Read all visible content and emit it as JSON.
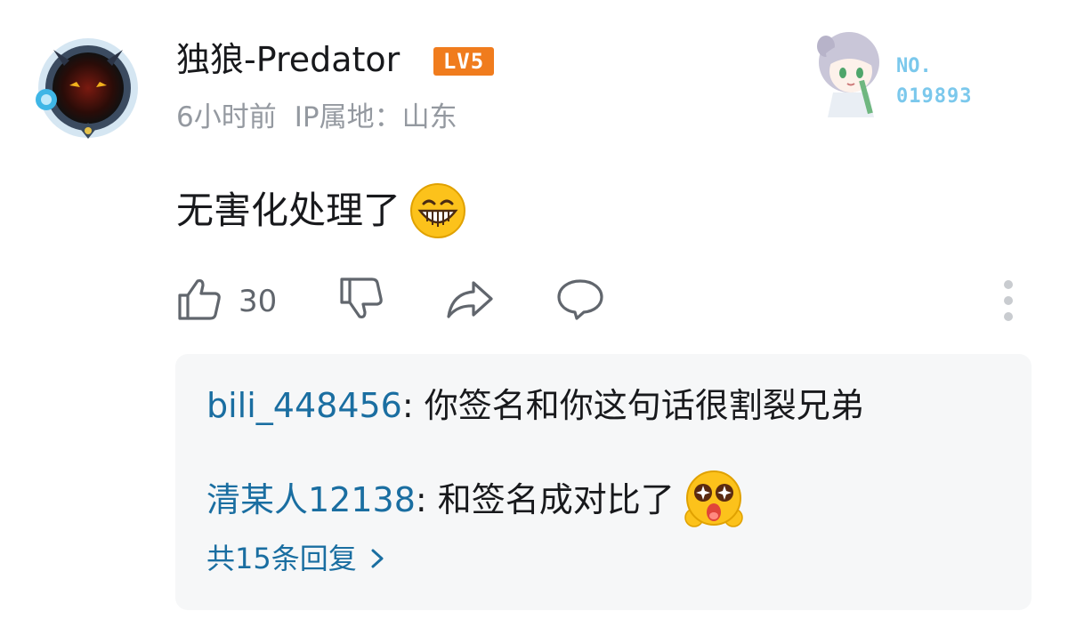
{
  "comment": {
    "username": "独狼-Predator",
    "level_badge": "LV5",
    "time": "6小时前",
    "ip_location": "IP属地：山东",
    "content": "无害化处理了",
    "content_emoji": "grinning-face-emoji",
    "likes": "30"
  },
  "fan_badge": {
    "label": "NO.",
    "number": "019893"
  },
  "replies": {
    "items": [
      {
        "user": "bili_448456",
        "text": ": 你签名和你这句话很割裂兄弟",
        "emoji": ""
      },
      {
        "user": "清某人12138",
        "text": ": 和签名成对比了",
        "emoji": "star-eyes-emoji"
      }
    ],
    "more_label": "共15条回复"
  },
  "icons": {
    "like": "thumbs-up-icon",
    "dislike": "thumbs-down-icon",
    "share": "share-icon",
    "reply": "comment-bubble-icon",
    "more": "more-vertical-icon"
  },
  "colors": {
    "link_blue": "#1a6ea1",
    "meta_gray": "#9499a0",
    "level_orange": "#f07c1d",
    "reply_bg": "#f6f7f8",
    "fan_blue": "#7bc8ec"
  }
}
